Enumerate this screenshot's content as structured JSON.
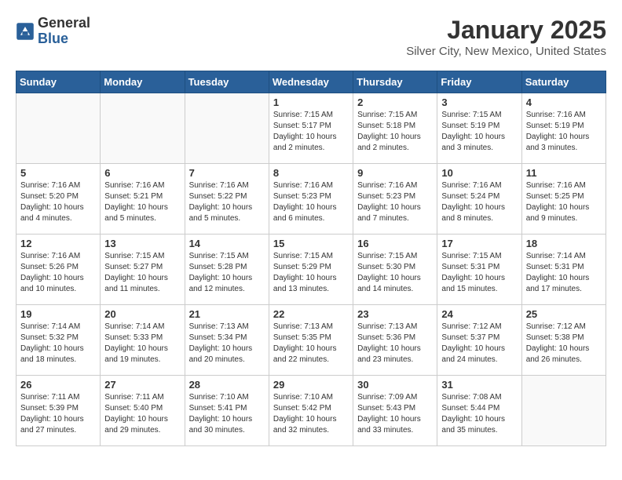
{
  "header": {
    "logo_general": "General",
    "logo_blue": "Blue",
    "month_title": "January 2025",
    "location": "Silver City, New Mexico, United States"
  },
  "weekdays": [
    "Sunday",
    "Monday",
    "Tuesday",
    "Wednesday",
    "Thursday",
    "Friday",
    "Saturday"
  ],
  "weeks": [
    [
      {
        "day": "",
        "sunrise": "",
        "sunset": "",
        "daylight": ""
      },
      {
        "day": "",
        "sunrise": "",
        "sunset": "",
        "daylight": ""
      },
      {
        "day": "",
        "sunrise": "",
        "sunset": "",
        "daylight": ""
      },
      {
        "day": "1",
        "sunrise": "Sunrise: 7:15 AM",
        "sunset": "Sunset: 5:17 PM",
        "daylight": "Daylight: 10 hours and 2 minutes."
      },
      {
        "day": "2",
        "sunrise": "Sunrise: 7:15 AM",
        "sunset": "Sunset: 5:18 PM",
        "daylight": "Daylight: 10 hours and 2 minutes."
      },
      {
        "day": "3",
        "sunrise": "Sunrise: 7:15 AM",
        "sunset": "Sunset: 5:19 PM",
        "daylight": "Daylight: 10 hours and 3 minutes."
      },
      {
        "day": "4",
        "sunrise": "Sunrise: 7:16 AM",
        "sunset": "Sunset: 5:19 PM",
        "daylight": "Daylight: 10 hours and 3 minutes."
      }
    ],
    [
      {
        "day": "5",
        "sunrise": "Sunrise: 7:16 AM",
        "sunset": "Sunset: 5:20 PM",
        "daylight": "Daylight: 10 hours and 4 minutes."
      },
      {
        "day": "6",
        "sunrise": "Sunrise: 7:16 AM",
        "sunset": "Sunset: 5:21 PM",
        "daylight": "Daylight: 10 hours and 5 minutes."
      },
      {
        "day": "7",
        "sunrise": "Sunrise: 7:16 AM",
        "sunset": "Sunset: 5:22 PM",
        "daylight": "Daylight: 10 hours and 5 minutes."
      },
      {
        "day": "8",
        "sunrise": "Sunrise: 7:16 AM",
        "sunset": "Sunset: 5:23 PM",
        "daylight": "Daylight: 10 hours and 6 minutes."
      },
      {
        "day": "9",
        "sunrise": "Sunrise: 7:16 AM",
        "sunset": "Sunset: 5:23 PM",
        "daylight": "Daylight: 10 hours and 7 minutes."
      },
      {
        "day": "10",
        "sunrise": "Sunrise: 7:16 AM",
        "sunset": "Sunset: 5:24 PM",
        "daylight": "Daylight: 10 hours and 8 minutes."
      },
      {
        "day": "11",
        "sunrise": "Sunrise: 7:16 AM",
        "sunset": "Sunset: 5:25 PM",
        "daylight": "Daylight: 10 hours and 9 minutes."
      }
    ],
    [
      {
        "day": "12",
        "sunrise": "Sunrise: 7:16 AM",
        "sunset": "Sunset: 5:26 PM",
        "daylight": "Daylight: 10 hours and 10 minutes."
      },
      {
        "day": "13",
        "sunrise": "Sunrise: 7:15 AM",
        "sunset": "Sunset: 5:27 PM",
        "daylight": "Daylight: 10 hours and 11 minutes."
      },
      {
        "day": "14",
        "sunrise": "Sunrise: 7:15 AM",
        "sunset": "Sunset: 5:28 PM",
        "daylight": "Daylight: 10 hours and 12 minutes."
      },
      {
        "day": "15",
        "sunrise": "Sunrise: 7:15 AM",
        "sunset": "Sunset: 5:29 PM",
        "daylight": "Daylight: 10 hours and 13 minutes."
      },
      {
        "day": "16",
        "sunrise": "Sunrise: 7:15 AM",
        "sunset": "Sunset: 5:30 PM",
        "daylight": "Daylight: 10 hours and 14 minutes."
      },
      {
        "day": "17",
        "sunrise": "Sunrise: 7:15 AM",
        "sunset": "Sunset: 5:31 PM",
        "daylight": "Daylight: 10 hours and 15 minutes."
      },
      {
        "day": "18",
        "sunrise": "Sunrise: 7:14 AM",
        "sunset": "Sunset: 5:31 PM",
        "daylight": "Daylight: 10 hours and 17 minutes."
      }
    ],
    [
      {
        "day": "19",
        "sunrise": "Sunrise: 7:14 AM",
        "sunset": "Sunset: 5:32 PM",
        "daylight": "Daylight: 10 hours and 18 minutes."
      },
      {
        "day": "20",
        "sunrise": "Sunrise: 7:14 AM",
        "sunset": "Sunset: 5:33 PM",
        "daylight": "Daylight: 10 hours and 19 minutes."
      },
      {
        "day": "21",
        "sunrise": "Sunrise: 7:13 AM",
        "sunset": "Sunset: 5:34 PM",
        "daylight": "Daylight: 10 hours and 20 minutes."
      },
      {
        "day": "22",
        "sunrise": "Sunrise: 7:13 AM",
        "sunset": "Sunset: 5:35 PM",
        "daylight": "Daylight: 10 hours and 22 minutes."
      },
      {
        "day": "23",
        "sunrise": "Sunrise: 7:13 AM",
        "sunset": "Sunset: 5:36 PM",
        "daylight": "Daylight: 10 hours and 23 minutes."
      },
      {
        "day": "24",
        "sunrise": "Sunrise: 7:12 AM",
        "sunset": "Sunset: 5:37 PM",
        "daylight": "Daylight: 10 hours and 24 minutes."
      },
      {
        "day": "25",
        "sunrise": "Sunrise: 7:12 AM",
        "sunset": "Sunset: 5:38 PM",
        "daylight": "Daylight: 10 hours and 26 minutes."
      }
    ],
    [
      {
        "day": "26",
        "sunrise": "Sunrise: 7:11 AM",
        "sunset": "Sunset: 5:39 PM",
        "daylight": "Daylight: 10 hours and 27 minutes."
      },
      {
        "day": "27",
        "sunrise": "Sunrise: 7:11 AM",
        "sunset": "Sunset: 5:40 PM",
        "daylight": "Daylight: 10 hours and 29 minutes."
      },
      {
        "day": "28",
        "sunrise": "Sunrise: 7:10 AM",
        "sunset": "Sunset: 5:41 PM",
        "daylight": "Daylight: 10 hours and 30 minutes."
      },
      {
        "day": "29",
        "sunrise": "Sunrise: 7:10 AM",
        "sunset": "Sunset: 5:42 PM",
        "daylight": "Daylight: 10 hours and 32 minutes."
      },
      {
        "day": "30",
        "sunrise": "Sunrise: 7:09 AM",
        "sunset": "Sunset: 5:43 PM",
        "daylight": "Daylight: 10 hours and 33 minutes."
      },
      {
        "day": "31",
        "sunrise": "Sunrise: 7:08 AM",
        "sunset": "Sunset: 5:44 PM",
        "daylight": "Daylight: 10 hours and 35 minutes."
      },
      {
        "day": "",
        "sunrise": "",
        "sunset": "",
        "daylight": ""
      }
    ]
  ]
}
